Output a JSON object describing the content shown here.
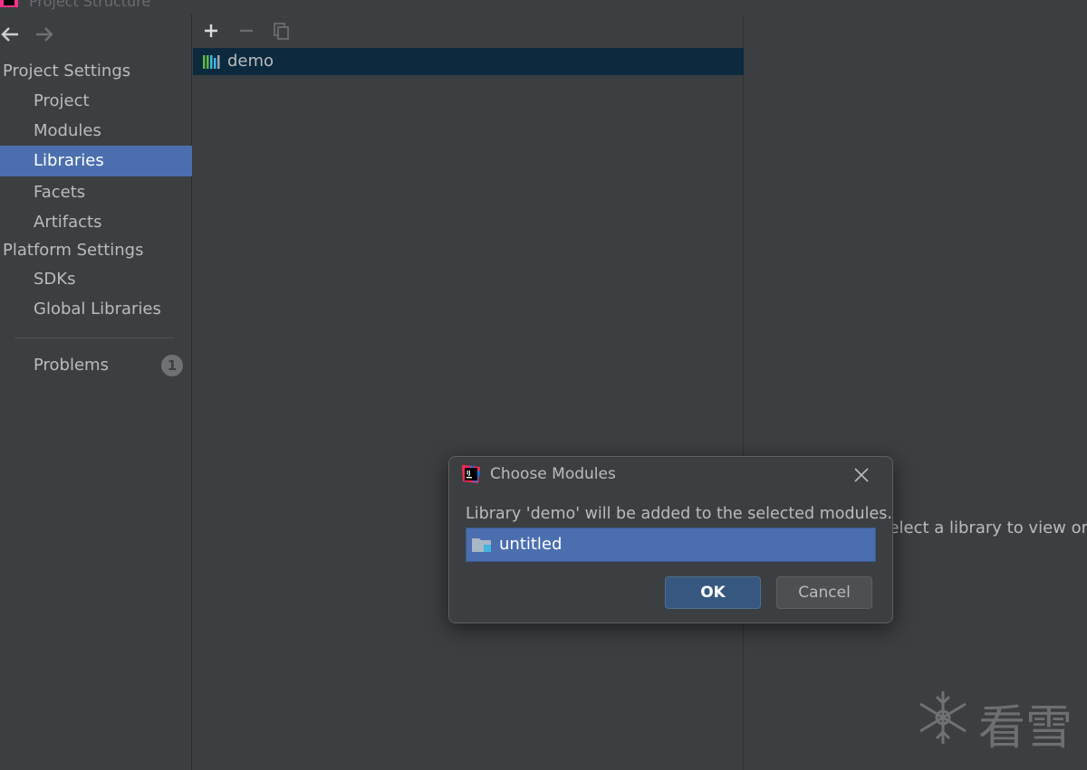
{
  "window": {
    "title": "Project Structure",
    "app_icon": "intellij-icon"
  },
  "nav": {
    "back_icon": "arrow-left-icon",
    "forward_icon": "arrow-right-icon"
  },
  "sidebar": {
    "project_settings_header": "Project Settings",
    "project_items": [
      {
        "label": "Project"
      },
      {
        "label": "Modules"
      },
      {
        "label": "Libraries",
        "selected": true
      },
      {
        "label": "Facets"
      },
      {
        "label": "Artifacts"
      }
    ],
    "platform_settings_header": "Platform Settings",
    "platform_items": [
      {
        "label": "SDKs"
      },
      {
        "label": "Global Libraries"
      }
    ],
    "problems": {
      "label": "Problems",
      "count": "1"
    }
  },
  "toolbar": {
    "add_icon": "plus-icon",
    "remove_icon": "minus-icon",
    "copy_icon": "copy-icon"
  },
  "libraries": [
    {
      "name": "demo",
      "icon": "library-icon"
    }
  ],
  "right_panel": {
    "empty_text": "Select a library to view or edit its details here"
  },
  "dialog": {
    "title": "Choose Modules",
    "message": "Library 'demo' will be added to the selected modules.",
    "modules": [
      {
        "name": "untitled",
        "icon": "module-folder-icon"
      }
    ],
    "ok_label": "OK",
    "cancel_label": "Cancel",
    "close_icon": "close-icon"
  },
  "watermark": {
    "text": "看雪",
    "icon": "snowflake-icon"
  },
  "colors": {
    "background": "#3c3f41",
    "selection": "#4b6eaf",
    "list_selection_inactive": "#0d293e",
    "ok_button": "#365880",
    "text": "#bbbbbb"
  }
}
